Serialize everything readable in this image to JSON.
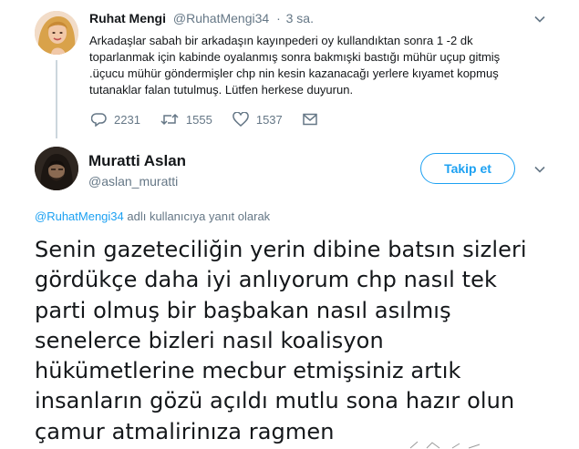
{
  "parent_tweet": {
    "author_name": "Ruhat Mengi",
    "author_handle": "@RuhatMengi34",
    "separator": "·",
    "time": "3 sa.",
    "text_lines": [
      "Arkadaşlar sabah bir arkadaşın kayınpederi oy kullandıktan sonra 1 -2 dk",
      "toparlanmak için kabinde oyalanmış sonra bakmışki bastığı mühür uçup gitmiş",
      ".üçucu mühür göndermişler chp nin kesin kazanacağı yerlere kıyamet kopmuş",
      "tutanaklar falan tutulmuş. Lütfen herkese duyurun."
    ],
    "reply_count": "2231",
    "retweet_count": "1555",
    "like_count": "1537"
  },
  "reply_tweet": {
    "author_name": "Muratti Aslan",
    "author_handle": "@aslan_muratti",
    "follow_label": "Takip et",
    "replying_to_handle": "@RuhatMengi34",
    "replying_to_suffix": " adlı kullanıcıya yanıt olarak",
    "text_lines": [
      "Senin gazeteciliğin yerin dibine batsın sizleri",
      "gördükçe daha iyi anlıyorum chp nasıl tek",
      "parti olmuş bir başbakan nasıl asılmış",
      "senelerce bizleri nasıl koalisyon",
      "hükümetlerine mecbur etmişsiniz artık",
      "insanların gözü açıldı mutlu sona hazır olun",
      "çamur atmalirinıza ragmen"
    ]
  },
  "icons": {
    "reply": "reply-icon",
    "retweet": "retweet-icon",
    "like": "heart-icon",
    "dm": "envelope-icon",
    "more": "chevron-down-icon"
  },
  "colors": {
    "accent": "#1da1f2",
    "secondary_text": "#657786",
    "primary_text": "#14171a",
    "thread_line": "#ccd6dd"
  }
}
